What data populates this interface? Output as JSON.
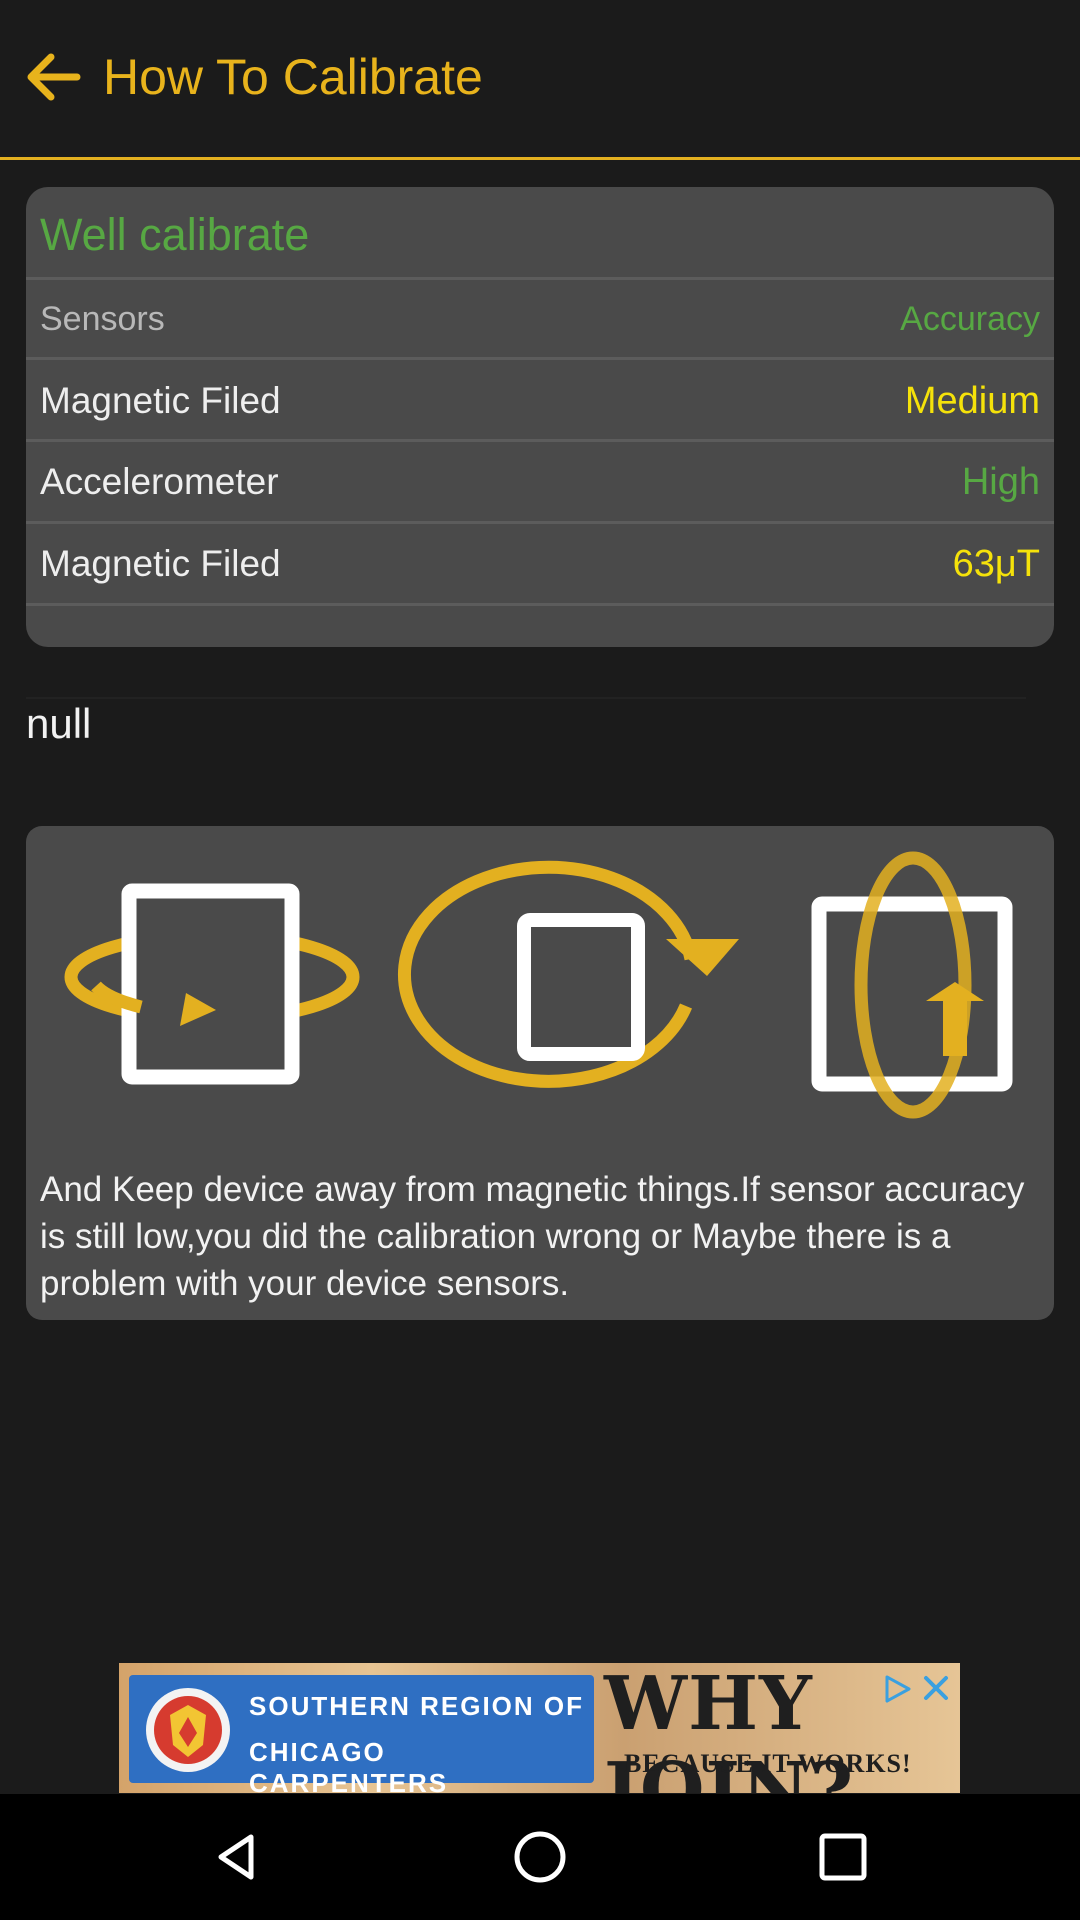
{
  "appbar": {
    "title": "How To Calibrate",
    "back_icon": "arrow-left-icon"
  },
  "status_card": {
    "title": "Well calibrate",
    "header": {
      "sensors": "Sensors",
      "accuracy": "Accuracy"
    },
    "rows": [
      {
        "label": "Magnetic Filed",
        "value": "Medium",
        "value_color": "#f5e20a"
      },
      {
        "label": "Accelerometer",
        "value": "High",
        "value_color": "#57a843"
      },
      {
        "label": "Magnetic Filed",
        "value": "63μT",
        "value_color": "#f5e20a"
      }
    ]
  },
  "null_text": "null",
  "instructions": {
    "icons": [
      "rotate-horizontal-icon",
      "rotate-flat-icon",
      "rotate-vertical-icon"
    ],
    "text": "And Keep device away from magnetic things.If sensor accuracy is still low,you did the calibration wrong or Maybe there is a problem with your device sensors."
  },
  "ad": {
    "line1": "SOUTHERN REGION OF",
    "line2": "CHICAGO CARPENTERS",
    "headline": "WHY JOIN?",
    "subline": "BECAUSE IT WORKS!"
  },
  "colors": {
    "accent": "#e3b020",
    "green": "#57a843",
    "yellow": "#f5e20a",
    "card": "#4a4a4a",
    "background": "#1b1b1b"
  },
  "navbar": {
    "icons": [
      "back-triangle-icon",
      "home-circle-icon",
      "recents-square-icon"
    ]
  }
}
